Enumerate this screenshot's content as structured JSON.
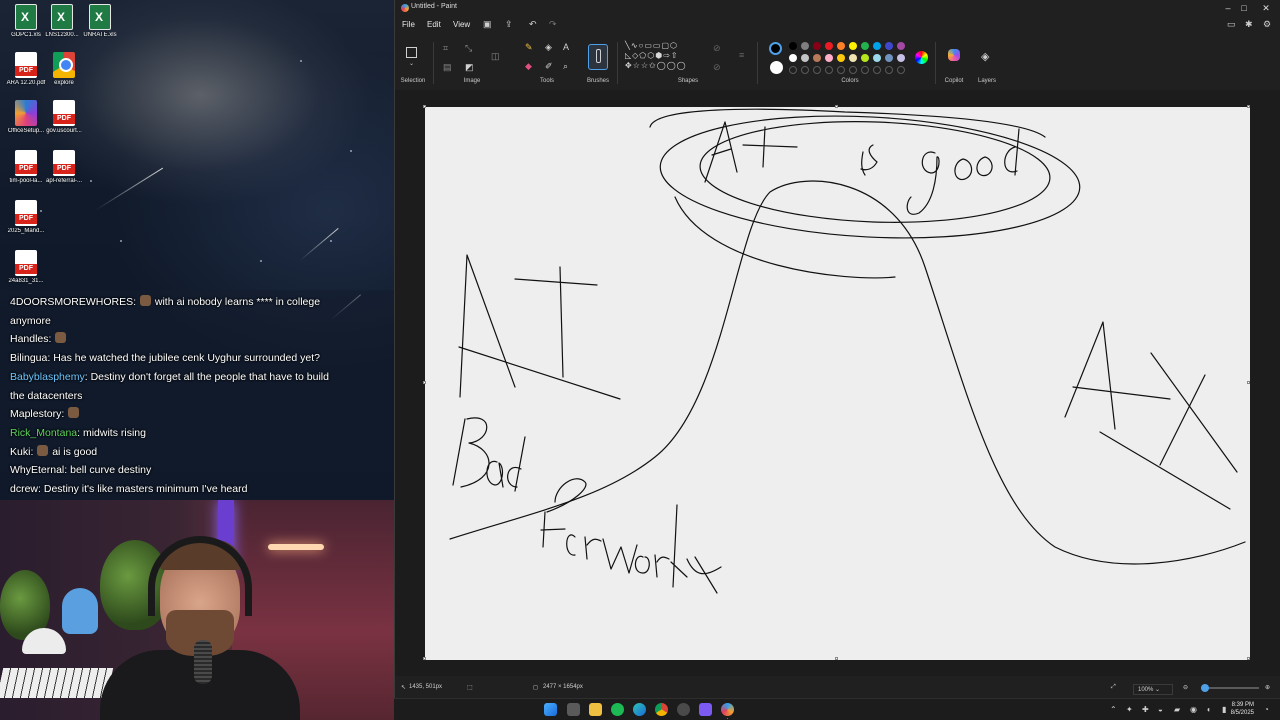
{
  "desktop": {
    "icons": [
      {
        "label": "GDPC1.xls",
        "type": "xls"
      },
      {
        "label": "LNS12300...",
        "type": "xls"
      },
      {
        "label": "UNRATE.xls",
        "type": "xls"
      },
      {
        "label": "ARA 12.20.pdf",
        "type": "pdf"
      },
      {
        "label": "explore",
        "type": "chrome"
      },
      {
        "label": "OfficeSetup...",
        "type": "office"
      },
      {
        "label": "gov.uscourt...",
        "type": "pdf"
      },
      {
        "label": "tim-pool-la...",
        "type": "pdf"
      },
      {
        "label": "apl-referral-...",
        "type": "pdf"
      },
      {
        "label": "2025_Mand...",
        "type": "pdf"
      },
      {
        "label": "24a831_31...",
        "type": "pdf"
      }
    ]
  },
  "chat": {
    "messages": [
      {
        "user": "4DOORSMOREWHORES",
        "color": "#ffffff",
        "text": "with ai nobody learns **** in college",
        "emote": true
      },
      {
        "user": "",
        "color": "#ffffff",
        "text": "anymore",
        "emote": false
      },
      {
        "user": "Handles",
        "color": "#ffffff",
        "text": "",
        "emote": true
      },
      {
        "user": "Bilingua",
        "color": "#ffffff",
        "text": "Has he watched the jubilee cenk Uyghur surrounded yet?",
        "emote": false
      },
      {
        "user": "Babyblasphemy",
        "color": "#6ec6ff",
        "text": "Destiny don't forget all the people that have to build",
        "emote": false
      },
      {
        "user": "",
        "color": "#ffffff",
        "text": "the datacenters",
        "emote": false
      },
      {
        "user": "Maplestory",
        "color": "#ffffff",
        "text": "",
        "emote": true
      },
      {
        "user": "Rick_Montana",
        "color": "#5fd35f",
        "text": "midwits rising",
        "emote": false
      },
      {
        "user": "Kuki",
        "color": "#ffffff",
        "text": "ai is good",
        "emote": true
      },
      {
        "user": "WhyEternal",
        "color": "#ffffff",
        "text": "bell curve destiny",
        "emote": false
      },
      {
        "user": "dcrew",
        "color": "#ffffff",
        "text": "Destiny it's like masters minimum I've heard",
        "emote": false
      }
    ]
  },
  "paint": {
    "title": "Untitled - Paint",
    "menu": [
      "File",
      "Edit",
      "View"
    ],
    "groups": {
      "selection": "Selection",
      "image": "Image",
      "tools": "Tools",
      "brushes": "Brushes",
      "shapes": "Shapes",
      "colors": "Colors",
      "copilot": "Copilot",
      "layers": "Layers"
    },
    "current_colors": {
      "primary": "#000000",
      "secondary": "#ffffff"
    },
    "palette_row1": [
      "#000000",
      "#7f7f7f",
      "#880015",
      "#ed1c24",
      "#ff7f27",
      "#fff200",
      "#22b14c",
      "#00a2e8",
      "#3f48cc",
      "#a349a4"
    ],
    "palette_row2": [
      "#ffffff",
      "#c3c3c3",
      "#b97a57",
      "#ffaec9",
      "#ffc90e",
      "#efe4b0",
      "#b5e61d",
      "#99d9ea",
      "#7092be",
      "#c8bfe7"
    ],
    "status": {
      "cursor": "1435, 501px",
      "canvas_size": "2477 × 1654px",
      "zoom": "100%"
    }
  },
  "drawing": {
    "texts": [
      "AI is good",
      "AI",
      "Bad",
      "For work",
      "AI"
    ]
  },
  "taskbar": {
    "time": "8:39 PM",
    "date": "8/5/2025"
  }
}
